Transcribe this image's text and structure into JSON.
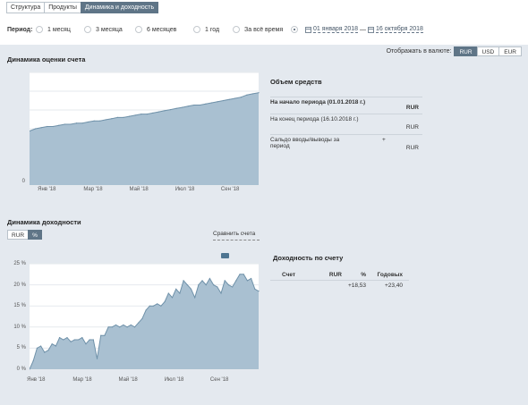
{
  "tabs": [
    {
      "label": "Структура",
      "active": false
    },
    {
      "label": "Продукты",
      "active": false
    },
    {
      "label": "Динамика и доходность",
      "active": true
    }
  ],
  "period": {
    "label": "Период:",
    "options": [
      {
        "label": "1 месяц",
        "selected": false
      },
      {
        "label": "3 месяца",
        "selected": false
      },
      {
        "label": "6 месяцев",
        "selected": false
      },
      {
        "label": "1 год",
        "selected": false
      },
      {
        "label": "За всё время",
        "selected": false
      },
      {
        "label": "",
        "selected": true
      }
    ],
    "date_from": "01 января 2018",
    "separator": "—",
    "date_to": "16 октября 2018"
  },
  "valuation": {
    "title": "Динамика оценки счета",
    "currency_label": "Отображать в валюте:",
    "currencies": [
      {
        "label": "RUR",
        "active": true
      },
      {
        "label": "USD",
        "active": false
      },
      {
        "label": "EUR",
        "active": false
      }
    ],
    "chart_data": {
      "type": "area",
      "x_labels": [
        "Янв '18",
        "Мар '18",
        "Май '18",
        "Июл '18",
        "Сен '18"
      ],
      "y_labels": [
        "0"
      ],
      "ylim": [
        0,
        1
      ],
      "grid": true,
      "values": [
        0.48,
        0.5,
        0.51,
        0.52,
        0.52,
        0.53,
        0.54,
        0.54,
        0.55,
        0.55,
        0.56,
        0.57,
        0.57,
        0.58,
        0.59,
        0.6,
        0.6,
        0.61,
        0.62,
        0.63,
        0.63,
        0.64,
        0.65,
        0.66,
        0.67,
        0.68,
        0.69,
        0.7,
        0.71,
        0.71,
        0.72,
        0.73,
        0.74,
        0.75,
        0.76,
        0.77,
        0.78,
        0.8,
        0.81,
        0.82
      ]
    }
  },
  "funds": {
    "title": "Объем средств",
    "rows": [
      {
        "label": "На начало периода (01.01.2018 г.)",
        "value": "RUR",
        "bold": true,
        "sign": ""
      },
      {
        "label": "На конец периода (16.10.2018 г.)",
        "value": "RUR",
        "bold": false,
        "sign": ""
      },
      {
        "label": "Сальдо вводы/выводы за период",
        "value": "RUR",
        "bold": false,
        "sign": "+"
      }
    ]
  },
  "yield_dynamics": {
    "title": "Динамика доходности",
    "toggle": [
      {
        "label": "RUR",
        "active": false
      },
      {
        "label": "%",
        "active": true
      }
    ],
    "compare_label": "Сравнить счета",
    "chart_data": {
      "type": "area",
      "x_labels": [
        "Янв '18",
        "Мар '18",
        "Май '18",
        "Июл '18",
        "Сен '18"
      ],
      "y_labels": [
        "25 %",
        "20 %",
        "15 %",
        "10 %",
        "5 %",
        "0 %"
      ],
      "ylim": [
        0,
        25
      ],
      "grid": true,
      "values": [
        0,
        2,
        5,
        5.5,
        4,
        4.5,
        6,
        5.5,
        7.5,
        7,
        7.5,
        6.5,
        7,
        7,
        7.5,
        6,
        7,
        7,
        2.5,
        8,
        8,
        10,
        10,
        10.5,
        10,
        10.5,
        10,
        10.5,
        10,
        11,
        12,
        14,
        15,
        15,
        15.5,
        15,
        16,
        18,
        17,
        19,
        18,
        21,
        20,
        19,
        17,
        20,
        21,
        20,
        21.5,
        20,
        19.5,
        18,
        21,
        20,
        19.5,
        21,
        22.5,
        22.5,
        21,
        21.5,
        19,
        18.5
      ]
    }
  },
  "yield_by_account": {
    "title": "Доходность по счету",
    "headers": [
      "Счет",
      "RUR",
      "%",
      "Годовых"
    ],
    "rows": [
      [
        "",
        "",
        "+18,53",
        "+23,40"
      ]
    ]
  }
}
